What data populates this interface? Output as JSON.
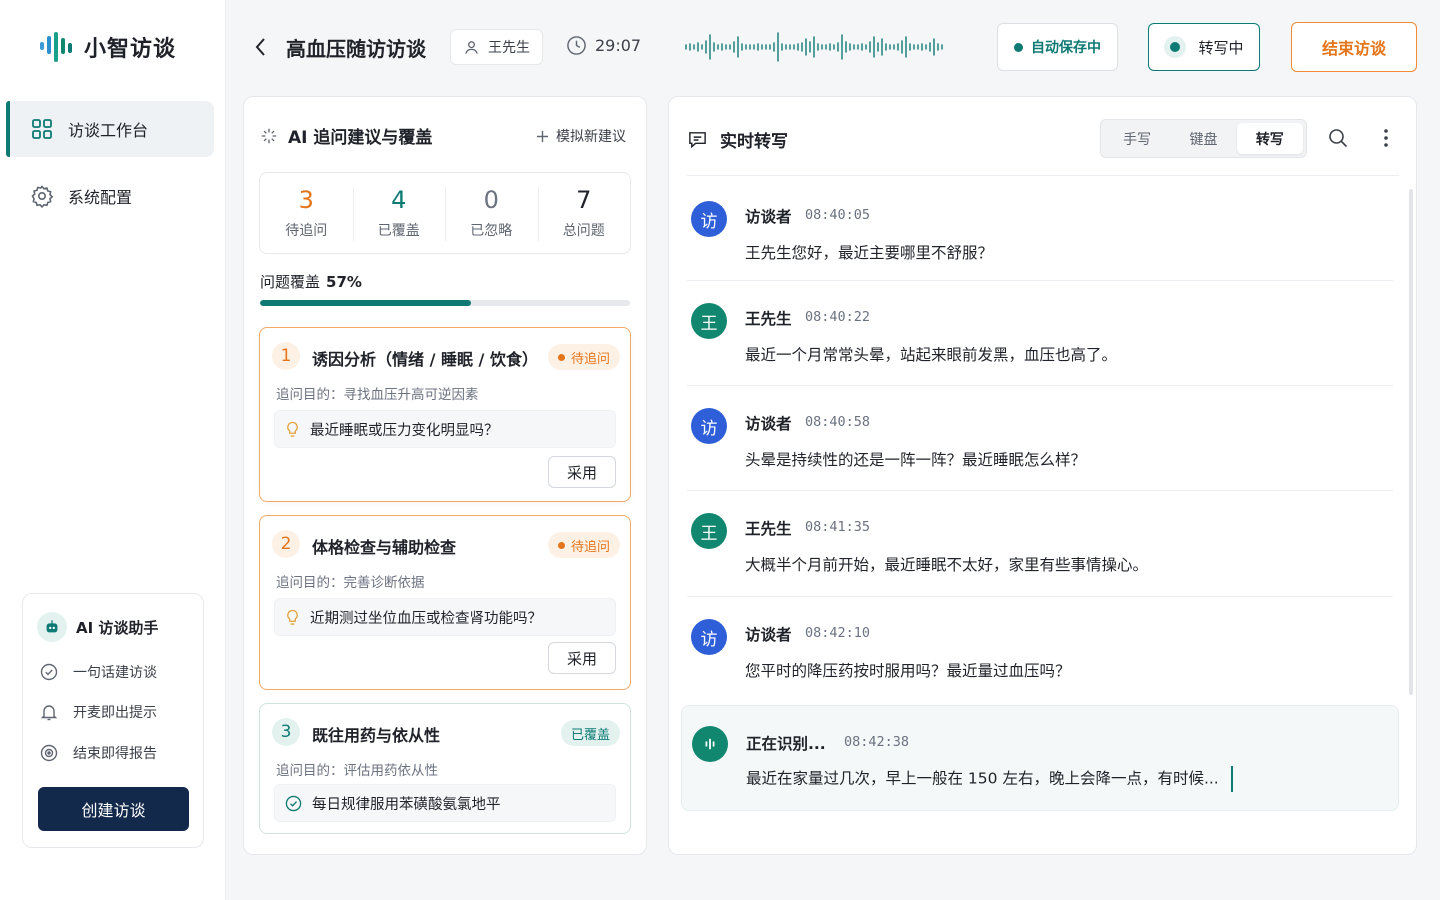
{
  "app": {
    "name": "小智访谈"
  },
  "sidebar": {
    "items": [
      {
        "label": "访谈工作台",
        "icon": "grid-icon",
        "active": true
      },
      {
        "label": "系统配置",
        "icon": "gear-icon",
        "active": false
      }
    ],
    "assistant": {
      "title": "AI 访谈助手",
      "features": [
        {
          "label": "一句话建访谈",
          "icon": "check-circle-icon"
        },
        {
          "label": "开麦即出提示",
          "icon": "bell-icon"
        },
        {
          "label": "结束即得报告",
          "icon": "target-icon"
        }
      ],
      "create_button": "创建访谈"
    }
  },
  "header": {
    "title": "高血压随访访谈",
    "interviewee": "王先生",
    "timer": "29:07",
    "autosave": "自动保存中",
    "transcribe": "转写中",
    "end_button": "结束访谈"
  },
  "suggestions": {
    "title": "AI 追问建议与覆盖",
    "action": "模拟新建议",
    "stats": [
      {
        "value": "3",
        "label": "待追问",
        "color": "#e5751a"
      },
      {
        "value": "4",
        "label": "已覆盖",
        "color": "#0d7a73"
      },
      {
        "value": "0",
        "label": "已忽略",
        "color": "#6b7280"
      },
      {
        "value": "7",
        "label": "总问题",
        "color": "#1f2329"
      }
    ],
    "coverage_label": "问题覆盖",
    "coverage_text": "57%",
    "coverage_value": 0.57,
    "cards": [
      {
        "num": "1",
        "title": "诱因分析（情绪 / 睡眠 / 饮食）",
        "status": "待追问",
        "purpose": "追问目的：寻找血压升高可逆因素",
        "suggestion": "最近睡眠或压力变化明显吗？",
        "adopt": "采用"
      },
      {
        "num": "2",
        "title": "体格检查与辅助检查",
        "status": "待追问",
        "purpose": "追问目的：完善诊断依据",
        "suggestion": "近期测过坐位血压或检查肾功能吗？",
        "adopt": "采用"
      },
      {
        "num": "3",
        "title": "既往用药与依从性",
        "status": "已覆盖",
        "purpose": "追问目的：评估用药依从性",
        "suggestion": "每日规律服用苯磺酸氨氯地平"
      }
    ]
  },
  "transcript": {
    "title": "实时转写",
    "modes": [
      "手写",
      "键盘",
      "转写"
    ],
    "active_mode": "转写",
    "messages": [
      {
        "avatar": "访",
        "speaker": "访谈者",
        "time": "08:40:05",
        "text": "王先生您好，最近主要哪里不舒服？"
      },
      {
        "avatar": "王",
        "speaker": "王先生",
        "time": "08:40:22",
        "text": "最近一个月常常头晕，站起来眼前发黑，血压也高了。"
      },
      {
        "avatar": "访",
        "speaker": "访谈者",
        "time": "08:40:58",
        "text": "头晕是持续性的还是一阵一阵？最近睡眠怎么样？"
      },
      {
        "avatar": "王",
        "speaker": "王先生",
        "time": "08:41:35",
        "text": "大概半个月前开始，最近睡眠不太好，家里有些事情操心。"
      },
      {
        "avatar": "访",
        "speaker": "访谈者",
        "time": "08:42:10",
        "text": "您平时的降压药按时服用吗？最近量过血压吗？"
      }
    ],
    "live": {
      "status": "正在识别...",
      "time": "08:42:38",
      "text": "最近在家量过几次，早上一般在 150 左右，晚上会降一点，有时候..."
    }
  }
}
